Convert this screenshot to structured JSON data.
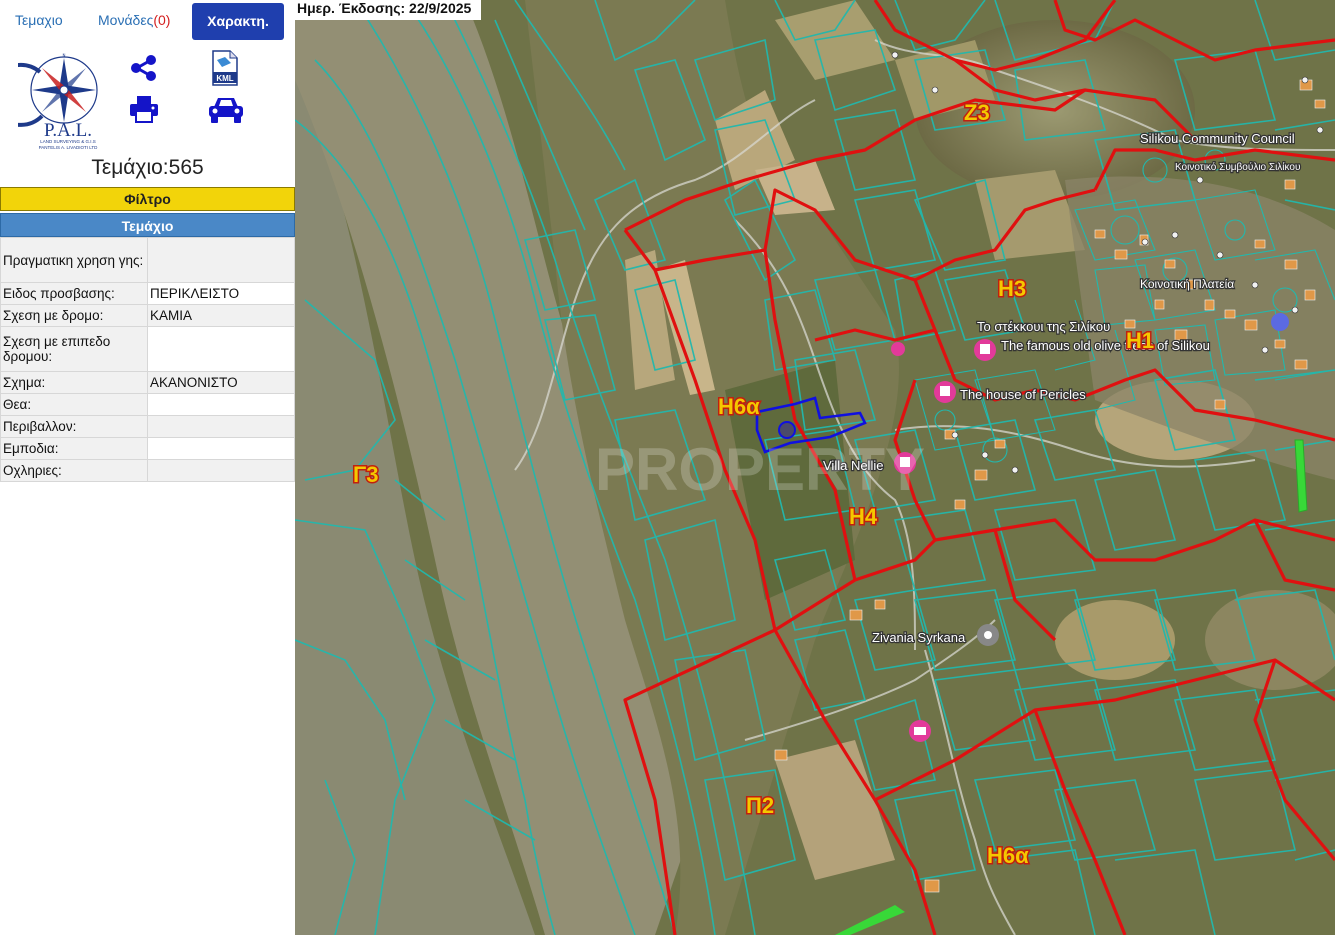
{
  "tabs": {
    "parcel_label": "Τεμαχιο",
    "units_label": "Μονάδες",
    "units_count": "(0)",
    "features_label": "Χαρακτη."
  },
  "logo": {
    "main_text": "P.A.L.",
    "subtitle": "LAND SURVEYING & G.I.S",
    "company": "PANTELIS A. LIVADIOTI LTD"
  },
  "toolbar": {
    "icons": [
      "share-icon",
      "kml-file-icon",
      "print-icon",
      "car-icon"
    ],
    "kml_label": "KML",
    "accent": "#1414c8"
  },
  "parcel": {
    "title": "Τεμάχιο:565"
  },
  "filter": {
    "label": "Φίλτρο",
    "color": "#f2d40a"
  },
  "section": {
    "label": "Τεμάχιο",
    "color": "#4a88c7"
  },
  "properties": [
    {
      "key": "Πραγματικη χρηση γης:",
      "value": ""
    },
    {
      "key": "Ειδος προσβασης:",
      "value": "ΠΕΡΙΚΛΕΙΣΤΟ"
    },
    {
      "key": "Σχεση με δρομο:",
      "value": "ΚΑΜΙΑ"
    },
    {
      "key": "Σχεση με επιπεδο δρομου:",
      "value": ""
    },
    {
      "key": "Σχημα:",
      "value": "ΑΚΑΝΟΝΙΣΤΟ"
    },
    {
      "key": "Θεα:",
      "value": ""
    },
    {
      "key": "Περιβαλλον:",
      "value": ""
    },
    {
      "key": "Εμποδια:",
      "value": ""
    },
    {
      "key": "Οχληριες:",
      "value": ""
    }
  ],
  "map": {
    "issue_date": "Ημερ. Έκδοσης: 22/9/2025",
    "watermark": "PROPERTY",
    "zone_labels": [
      "Ζ3",
      "Η3",
      "Η1",
      "Η6α",
      "Γ3",
      "Η4",
      "Π2",
      "Η6α"
    ],
    "places": [
      "Silikou Community Council",
      "Κοινοτικό Συμβούλιο Σιλίκου",
      "Κοινοτική Πλατεία",
      "Το στέκκουι της Σιλίκου",
      "The famous old olive trees of Silikou",
      "The house of Pericles",
      "Villa Nellie",
      "Zivania Syrkana"
    ],
    "colors": {
      "zone_boundary": "#e01010",
      "parcel_lines": "#22b8ad",
      "selected_parcel": "#1010e0",
      "zone_label": "#f5c800",
      "poi": "#e23a9a"
    }
  }
}
